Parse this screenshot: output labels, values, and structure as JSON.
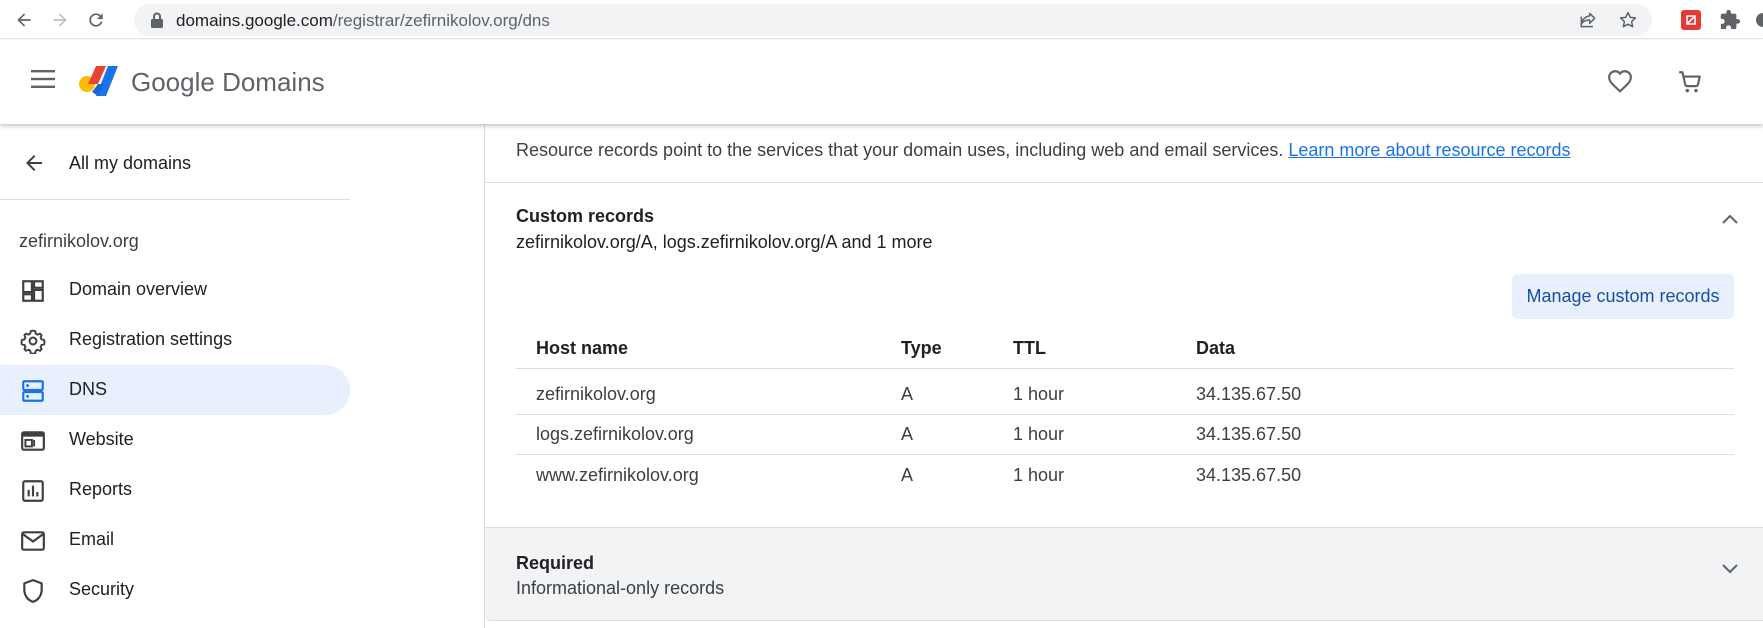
{
  "browser": {
    "url_host": "domains.google.com",
    "url_path": "/registrar/zefirnikolov.org/dns"
  },
  "header": {
    "brand_google": "Google",
    "brand_domains": " Domains"
  },
  "sidebar": {
    "back_label": "All my domains",
    "domain": "zefirnikolov.org",
    "items": [
      {
        "label": "Domain overview",
        "icon": "dashboard-icon"
      },
      {
        "label": "Registration settings",
        "icon": "gear-icon"
      },
      {
        "label": "DNS",
        "icon": "dns-icon",
        "active": true
      },
      {
        "label": "Website",
        "icon": "website-icon"
      },
      {
        "label": "Reports",
        "icon": "bar-chart-icon"
      },
      {
        "label": "Email",
        "icon": "mail-icon"
      },
      {
        "label": "Security",
        "icon": "shield-icon"
      }
    ]
  },
  "main": {
    "intro_text": "Resource records point to the services that your domain uses, including web and email services. ",
    "intro_link": "Learn more about resource records",
    "custom_records": {
      "title": "Custom records",
      "summary": "zefirnikolov.org/A, logs.zefirnikolov.org/A and 1 more",
      "manage_label": "Manage custom records",
      "columns": [
        "Host name",
        "Type",
        "TTL",
        "Data"
      ],
      "rows": [
        [
          "zefirnikolov.org",
          "A",
          "1 hour",
          "34.135.67.50"
        ],
        [
          "logs.zefirnikolov.org",
          "A",
          "1 hour",
          "34.135.67.50"
        ],
        [
          "www.zefirnikolov.org",
          "A",
          "1 hour",
          "34.135.67.50"
        ]
      ]
    },
    "required": {
      "title": "Required",
      "subtitle": "Informational-only records"
    }
  },
  "colors": {
    "accent": "#1a73e8",
    "active_nav_bg": "#e8f0fe",
    "manage_btn_bg": "#e8f0fe",
    "required_bg": "#f1f3f4"
  }
}
